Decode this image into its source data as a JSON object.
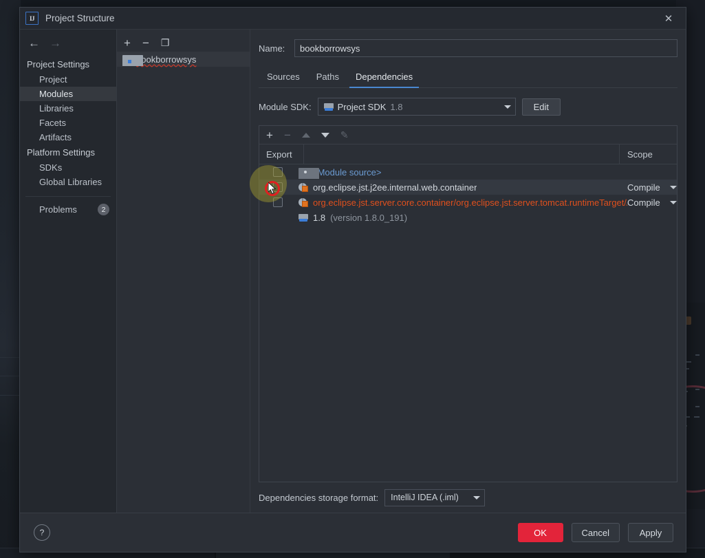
{
  "window": {
    "title": "Project Structure",
    "app_icon": "intellij-idea-logo",
    "close_label": "✕"
  },
  "nav": {
    "back": "←",
    "forward": "→"
  },
  "settings_tree": {
    "groups": [
      {
        "label": "Project Settings",
        "items": [
          {
            "label": "Project",
            "selected": false
          },
          {
            "label": "Modules",
            "selected": true
          },
          {
            "label": "Libraries",
            "selected": false
          },
          {
            "label": "Facets",
            "selected": false
          },
          {
            "label": "Artifacts",
            "selected": false
          }
        ]
      },
      {
        "label": "Platform Settings",
        "items": [
          {
            "label": "SDKs",
            "selected": false
          },
          {
            "label": "Global Libraries",
            "selected": false
          }
        ]
      }
    ],
    "problems": {
      "label": "Problems",
      "count": "2"
    }
  },
  "module_pane": {
    "toolbar": [
      {
        "name": "add-module-button",
        "glyph": "+"
      },
      {
        "name": "remove-module-button",
        "glyph": "−"
      },
      {
        "name": "copy-module-button",
        "glyph": "❐"
      }
    ],
    "modules": [
      {
        "name": "bookborrowsys",
        "selected": true
      }
    ]
  },
  "main": {
    "name_label": "Name:",
    "name_value": "bookborrowsys",
    "name_placeholder": "",
    "tabs": [
      {
        "label": "Sources",
        "active": false
      },
      {
        "label": "Paths",
        "active": false
      },
      {
        "label": "Dependencies",
        "active": true
      }
    ],
    "module_sdk_label": "Module SDK:",
    "module_sdk_value": "Project SDK",
    "module_sdk_version": "1.8",
    "edit_button": "Edit",
    "dep_toolbar": [
      {
        "name": "add-dependency-button",
        "glyph": "+",
        "enabled": true
      },
      {
        "name": "remove-dependency-button",
        "glyph": "−",
        "enabled": false
      },
      {
        "name": "move-up-button",
        "glyph": "▲",
        "enabled": false
      },
      {
        "name": "move-down-button",
        "glyph": "▼",
        "enabled": true
      },
      {
        "name": "edit-dependency-button",
        "glyph": "✎",
        "enabled": false
      }
    ],
    "table": {
      "columns": [
        "Export",
        "",
        "Scope"
      ],
      "rows": [
        {
          "export_checked": false,
          "icon": "module-source-icon",
          "text": "<Module source>",
          "text_color": "blue",
          "scope": "",
          "selected": false
        },
        {
          "export_checked": false,
          "icon": "library-icon",
          "text": "org.eclipse.jst.j2ee.internal.web.container",
          "text_color": "white",
          "scope": "Compile",
          "selected": true
        },
        {
          "export_checked": false,
          "icon": "library-icon",
          "text": "org.eclipse.jst.server.core.container/org.eclipse.jst.server.tomcat.runtimeTarget/Apache Tom",
          "text_color": "red",
          "scope": "Compile",
          "selected": false
        },
        {
          "export_checked": false,
          "icon": "sdk-icon",
          "text": "1.8",
          "text_suffix": "(version 1.8.0_191)",
          "text_color": "white",
          "scope": "",
          "selected": false
        }
      ]
    },
    "storage_label": "Dependencies storage format:",
    "storage_value": "IntelliJ IDEA (.iml)"
  },
  "footer": {
    "help": "?",
    "ok": "OK",
    "cancel": "Cancel",
    "apply": "Apply",
    "ok_color": "#e3243a"
  }
}
